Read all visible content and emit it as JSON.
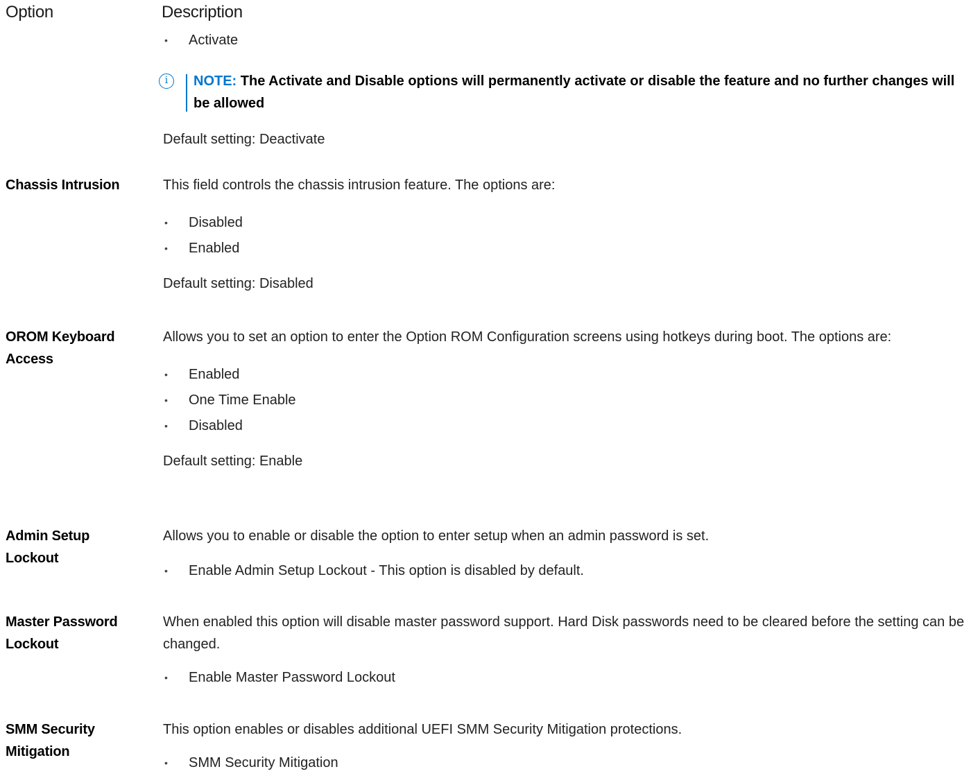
{
  "header": {
    "option_label": "Option",
    "description_label": "Description"
  },
  "intro": {
    "bullets": [
      "Activate"
    ],
    "note_prefix": "NOTE:",
    "note_text": "The Activate and Disable options will permanently activate or disable the feature and no further changes will be allowed",
    "default": "Default setting: Deactivate"
  },
  "options": [
    {
      "name": "Chassis Intrusion",
      "description": "This field controls the chassis intrusion feature. The options are:",
      "bullets": [
        "Disabled",
        "Enabled"
      ],
      "default": "Default setting: Disabled"
    },
    {
      "name": "OROM Keyboard Access",
      "description": "Allows you to set an option to enter the Option ROM Configuration screens using hotkeys during boot. The options are:",
      "bullets": [
        "Enabled",
        "One Time Enable",
        "Disabled"
      ],
      "default": "Default setting: Enable"
    },
    {
      "name": "Admin Setup Lockout",
      "description": "Allows you to enable or disable the option to enter setup when an admin password is set.",
      "bullets": [
        "Enable Admin Setup Lockout - This option is disabled by default."
      ]
    },
    {
      "name": "Master Password Lockout",
      "description": "When enabled this option will disable master password support. Hard Disk passwords need to be cleared before the setting can be changed.",
      "bullets": [
        "Enable Master Password Lockout"
      ]
    },
    {
      "name": "SMM Security Mitigation",
      "description": "This option enables or disables additional UEFI SMM Security Mitigation protections.",
      "bullets": [
        "SMM Security Mitigation"
      ]
    }
  ],
  "colors": {
    "note_accent": "#0076ce"
  },
  "icons": {
    "note": "info-circle-icon",
    "bullet": "bullet-dot-icon"
  }
}
